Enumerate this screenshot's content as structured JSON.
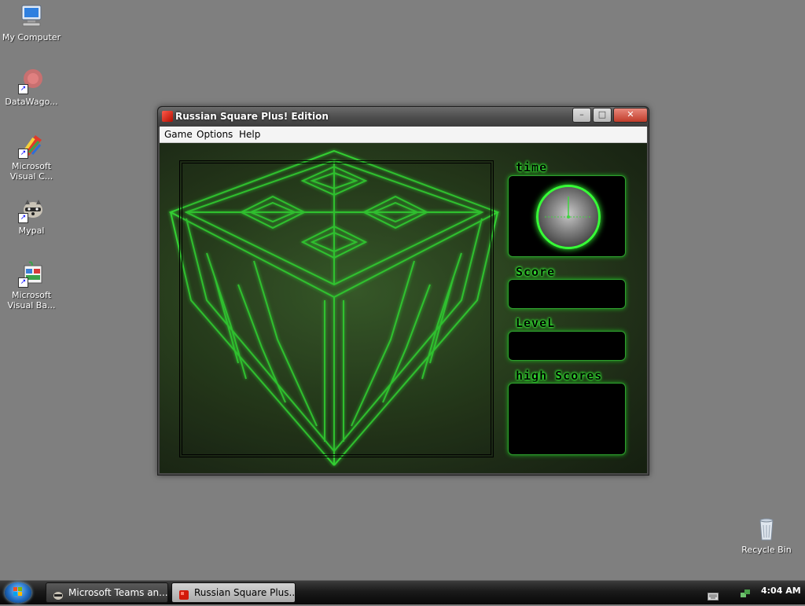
{
  "desktop": {
    "icons": [
      {
        "label": "My Computer"
      },
      {
        "label": "DataWago..."
      },
      {
        "label": "Microsoft Visual C..."
      },
      {
        "label": "Mypal"
      },
      {
        "label": "Microsoft Visual Ba..."
      },
      {
        "label": "Recycle Bin"
      }
    ]
  },
  "window": {
    "title": "Russian Square Plus! Edition",
    "menu": [
      "Game",
      "Options",
      "Help"
    ],
    "panels": {
      "time_label": "time",
      "score_label": "Score",
      "level_label": "LeveL",
      "high_scores_label": "high Scores"
    }
  },
  "taskbar": {
    "tasks": [
      {
        "label": "Microsoft Teams an..."
      },
      {
        "label": "Russian Square Plus..."
      }
    ],
    "clock": "4:04 AM"
  },
  "colors": {
    "desktop_bg": "#7f7f7f",
    "neon_green": "#39ff39",
    "taskbar": "#1a1a1a"
  }
}
